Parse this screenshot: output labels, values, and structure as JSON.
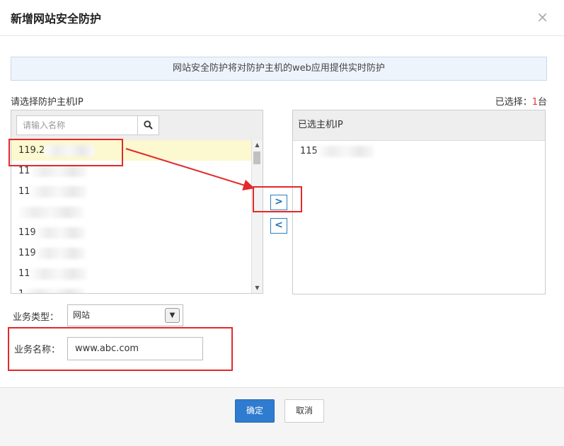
{
  "dialog": {
    "title": "新增网站安全防护",
    "close_glyph": "×",
    "notice": "网站安全防护将对防护主机的web应用提供实时防护"
  },
  "host_picker": {
    "label": "请选择防护主机IP",
    "selected_prefix": "已选择：",
    "selected_count": "1",
    "selected_unit": "台",
    "search_placeholder": "请输入名称",
    "search_icon": "search-icon",
    "available_hosts": [
      {
        "visible_prefix": "119.2"
      },
      {
        "visible_prefix": "11"
      },
      {
        "visible_prefix": "11"
      },
      {
        "visible_prefix": ""
      },
      {
        "visible_prefix": "119"
      },
      {
        "visible_prefix": "119"
      },
      {
        "visible_prefix": "11"
      },
      {
        "visible_prefix": "1"
      }
    ],
    "move_right_glyph": ">",
    "move_left_glyph": "<",
    "selected_header": "已选主机IP",
    "selected_hosts": [
      {
        "visible_prefix": "115"
      }
    ]
  },
  "form": {
    "type_label": "业务类型：",
    "type_value": "网站",
    "name_label": "业务名称：",
    "name_value": "www.abc.com"
  },
  "footer": {
    "ok_label": "确定",
    "cancel_label": "取消"
  },
  "colors": {
    "accent": "#2f7bd0",
    "annotation_red": "#e3292b",
    "highlight_row": "#fcf8cf"
  }
}
